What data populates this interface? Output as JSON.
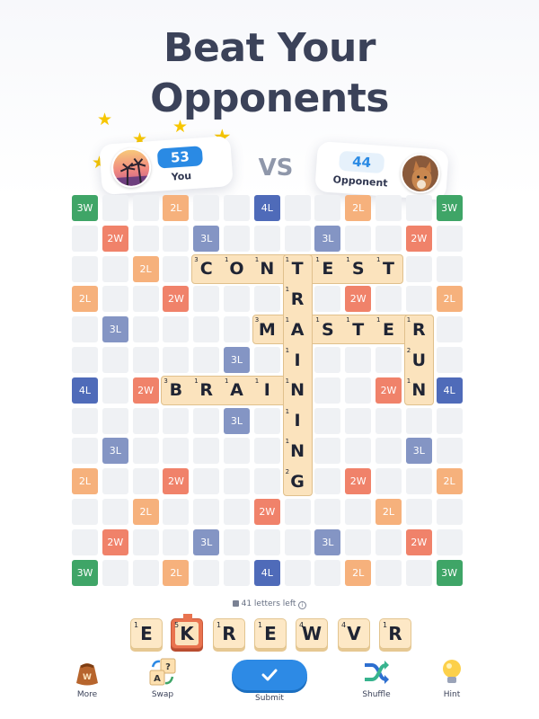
{
  "title": [
    "Beat Your",
    "Opponents"
  ],
  "players": {
    "you": {
      "name": "You",
      "score": "53"
    },
    "vs": "VS",
    "opponent": {
      "name": "Opponent",
      "score": "44"
    }
  },
  "board": {
    "premiums": [
      [
        "3W",
        0,
        0
      ],
      [
        "2L",
        3,
        0
      ],
      [
        "4L",
        6,
        0
      ],
      [
        "2L",
        9,
        0
      ],
      [
        "3W",
        12,
        0
      ],
      [
        "2W",
        1,
        1
      ],
      [
        "3L",
        4,
        1
      ],
      [
        "3L",
        8,
        1
      ],
      [
        "2W",
        11,
        1
      ],
      [
        "2L",
        2,
        2
      ],
      [
        "2L",
        10,
        2
      ],
      [
        "2L",
        0,
        3
      ],
      [
        "2W",
        3,
        3
      ],
      [
        "2W",
        9,
        3
      ],
      [
        "2L",
        12,
        3
      ],
      [
        "3L",
        1,
        4
      ],
      [
        "3L",
        11,
        4
      ],
      [
        "3L",
        5,
        5
      ],
      [
        "3L",
        7,
        5
      ],
      [
        "4L",
        0,
        6
      ],
      [
        "2W",
        2,
        6
      ],
      [
        "2W",
        10,
        6
      ],
      [
        "4L",
        12,
        6
      ],
      [
        "3L",
        5,
        7
      ],
      [
        "3L",
        7,
        7
      ],
      [
        "3L",
        1,
        8
      ],
      [
        "3L",
        11,
        8
      ],
      [
        "2L",
        0,
        9
      ],
      [
        "2W",
        3,
        9
      ],
      [
        "2W",
        9,
        9
      ],
      [
        "2L",
        12,
        9
      ],
      [
        "2L",
        2,
        10
      ],
      [
        "2W",
        6,
        10
      ],
      [
        "2L",
        10,
        10
      ],
      [
        "2W",
        1,
        11
      ],
      [
        "3L",
        4,
        11
      ],
      [
        "3L",
        8,
        11
      ],
      [
        "2W",
        11,
        11
      ],
      [
        "3W",
        0,
        12
      ],
      [
        "2L",
        3,
        12
      ],
      [
        "4L",
        6,
        12
      ],
      [
        "2L",
        9,
        12
      ],
      [
        "3W",
        12,
        12
      ]
    ],
    "words": [
      {
        "text": "CONTEST",
        "col": 4,
        "row": 2,
        "dir": "h",
        "points": [
          3,
          1,
          1,
          1,
          1,
          1,
          1
        ]
      },
      {
        "text": "MASTER",
        "col": 6,
        "row": 4,
        "dir": "h",
        "points": [
          3,
          1,
          1,
          1,
          1,
          1
        ]
      },
      {
        "text": "BRAIN",
        "col": 3,
        "row": 6,
        "dir": "h",
        "points": [
          3,
          1,
          1,
          1,
          1
        ]
      },
      {
        "text": "RUN",
        "col": 11,
        "row": 4,
        "dir": "v",
        "points": [
          1,
          2,
          1
        ]
      },
      {
        "text": "TRAINING",
        "col": 7,
        "row": 2,
        "dir": "v",
        "points": [
          1,
          1,
          1,
          1,
          1,
          1,
          1,
          2
        ]
      }
    ]
  },
  "letters_left": "41 letters left",
  "rack": [
    {
      "letter": "E",
      "points": "1",
      "selected": false
    },
    {
      "letter": "K",
      "points": "5",
      "selected": true
    },
    {
      "letter": "R",
      "points": "1",
      "selected": false
    },
    {
      "letter": "E",
      "points": "1",
      "selected": false
    },
    {
      "letter": "W",
      "points": "4",
      "selected": false
    },
    {
      "letter": "V",
      "points": "4",
      "selected": false
    },
    {
      "letter": "R",
      "points": "1",
      "selected": false
    }
  ],
  "toolbar": {
    "more": {
      "label": "More",
      "icon": "bag-icon"
    },
    "swap": {
      "label": "Swap",
      "icon": "swap-tiles-icon"
    },
    "submit": {
      "label": "Submit",
      "icon": "check-icon"
    },
    "shuffle": {
      "label": "Shuffle",
      "icon": "shuffle-icon"
    },
    "hint": {
      "label": "Hint",
      "icon": "lightbulb-icon"
    }
  },
  "colors": {
    "3W": "#3fa567",
    "2W": "#f0826a",
    "2L": "#f6b17c",
    "3L": "#8495c4",
    "4L": "#4f6bb9",
    "accent": "#2d8ae5"
  }
}
